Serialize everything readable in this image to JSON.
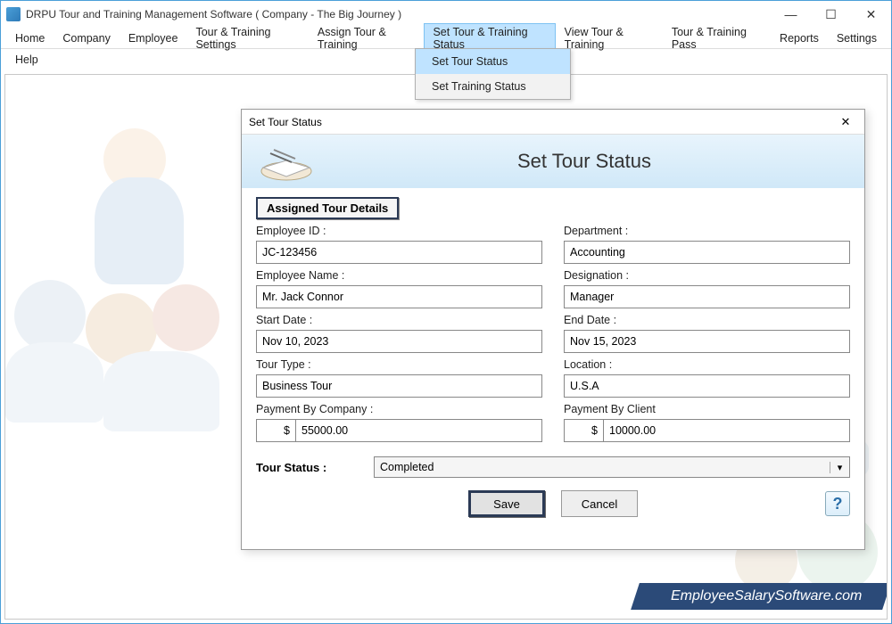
{
  "window": {
    "title": "DRPU Tour and Training Management Software  ( Company - The Big Journey )"
  },
  "menu": {
    "items": [
      "Home",
      "Company",
      "Employee",
      "Tour & Training Settings",
      "Assign Tour & Training",
      "Set Tour & Training Status",
      "View Tour & Training",
      "Tour & Training Pass",
      "Reports",
      "Settings"
    ],
    "row2": [
      "Help"
    ],
    "activeIndex": 5,
    "dropdown": {
      "items": [
        "Set Tour Status",
        "Set Training Status"
      ],
      "highlightIndex": 0
    }
  },
  "dialog": {
    "title": "Set Tour Status",
    "headerTitle": "Set Tour Status",
    "sectionLabel": "Assigned Tour Details",
    "fields": {
      "employeeId": {
        "label": "Employee ID :",
        "value": "JC-123456"
      },
      "department": {
        "label": "Department :",
        "value": "Accounting"
      },
      "employeeName": {
        "label": "Employee Name :",
        "value": "Mr. Jack Connor"
      },
      "designation": {
        "label": "Designation :",
        "value": "Manager"
      },
      "startDate": {
        "label": "Start Date :",
        "value": "Nov 10, 2023"
      },
      "endDate": {
        "label": "End Date :",
        "value": "Nov 15, 2023"
      },
      "tourType": {
        "label": "Tour Type :",
        "value": "Business Tour"
      },
      "location": {
        "label": "Location :",
        "value": "U.S.A"
      },
      "paymentCompany": {
        "label": "Payment By Company :",
        "currency": "$",
        "value": "55000.00"
      },
      "paymentClient": {
        "label": "Payment By Client",
        "currency": "$",
        "value": "10000.00"
      }
    },
    "status": {
      "label": "Tour Status :",
      "value": "Completed"
    },
    "buttons": {
      "save": "Save",
      "cancel": "Cancel"
    }
  },
  "watermark": "EmployeeSalarySoftware.com"
}
